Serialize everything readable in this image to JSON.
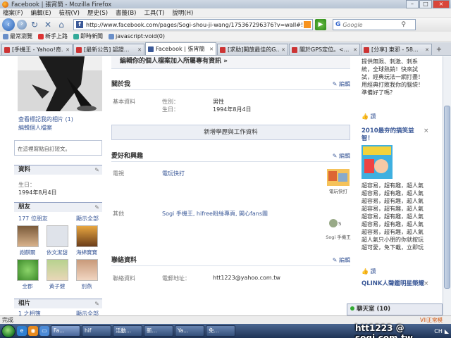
{
  "window": {
    "title": "Facebook | 張宵簡 - Mozilla Firefox"
  },
  "menu": [
    "檔案(F)",
    "編輯(E)",
    "檢視(V)",
    "歷史(S)",
    "書籤(B)",
    "工具(T)",
    "說明(H)"
  ],
  "nav": {
    "url": "http://www.facebook.com/pages/Sogi-shou-ji-wang/175367296376?v=wall#!/",
    "search_placeholder": "Google",
    "search_engine": "G"
  },
  "bookmarks": [
    "最常瀏覽",
    "新手上路",
    "即時新聞",
    "javascript:void(0)"
  ],
  "tabs": [
    {
      "label": "[手機王 - Yahoo!奇..."
    },
    {
      "label": "[最新公告] 認證..."
    },
    {
      "label": "Facebook | 張宵簡",
      "active": true
    },
    {
      "label": "[求助]開放最佳的G..."
    },
    {
      "label": "關於GPS定位。<..."
    },
    {
      "label": "[分享] 東邪 - 58..."
    }
  ],
  "left": {
    "view_photos": "查看標記我的相片 (1)",
    "edit_profile": "編輯個人檔案",
    "status_prompt": "在這裡寫點自訂短文。",
    "info_header": "資料",
    "birthday_label": "生日：",
    "birthday_value": "1994年8月4日",
    "friends_header": "朋友",
    "friends_count": "177 位朋友",
    "see_all": "顯示全部",
    "friends": [
      "謝麒爾",
      "依文潔甜",
      "海綿寶寶",
      "全郡",
      "黃子健",
      "別燕"
    ],
    "photos_header": "相片",
    "photos_count": "1 之相簿",
    "photos_see_all": "顯示全部"
  },
  "main": {
    "banner": "編輯你的個人檔案加入所屬專有資訊 »",
    "about_header": "關於我",
    "edit": "編輯",
    "basic_label": "基本資料",
    "gender_label": "性別：",
    "gender_value": "男性",
    "birthday_label": "生日：",
    "birthday_value": "1994年8月4日",
    "add_work": "新增學歷與工作資料",
    "likes_header": "愛好和興趣",
    "tv_label": "電視",
    "tv_value": "電玩快打",
    "tv_thumb_caption": "電玩快打",
    "other_label": "其他",
    "other_value": "Sogi 手機王, hifree粉絲專頁, 開心fans團",
    "other_thumb_caption": "Sogi 手機王",
    "contact_header": "聯絡資料",
    "contact_label": "聯絡資料",
    "email_label": "電郵地址：",
    "email_value": "htt1223@yahoo.com.tw"
  },
  "right": {
    "ad1_text": "提供無限、刺激、刺系統，全球熱銷！快來試試，經典玩法一網打盡！用經典打敗我你的腦袋！準備好了嗎？",
    "ad1_like": "讚",
    "ad2_title": "2010最夯的搞笑益智！",
    "ad2_text": "超容易，超有趣，超人氣超容易，超有趣，超人氣超容易，超有趣，超人氣超容易，超有趣，超人氣超容易，超有趣，超人氣超容易，超有趣，超人氣超容易，超有趣，超人氣超人氣只小朋的你就按玩超可愛，免下載，立即玩",
    "ad2_like": "讚",
    "ad3_title": "QLINK人聲鑑明星榮耀",
    "close": "×"
  },
  "chat": {
    "label": "聊天室 (10)"
  },
  "status": {
    "left": "完成",
    "right": "VII正常模"
  },
  "taskbar": {
    "buttons": [
      "Fa...",
      "hif",
      "活動...",
      "新...",
      "Ya...",
      "免..."
    ],
    "tray": [
      "CH",
      "◣"
    ],
    "watermark": "htt1223 @ sogi.com.tw"
  }
}
